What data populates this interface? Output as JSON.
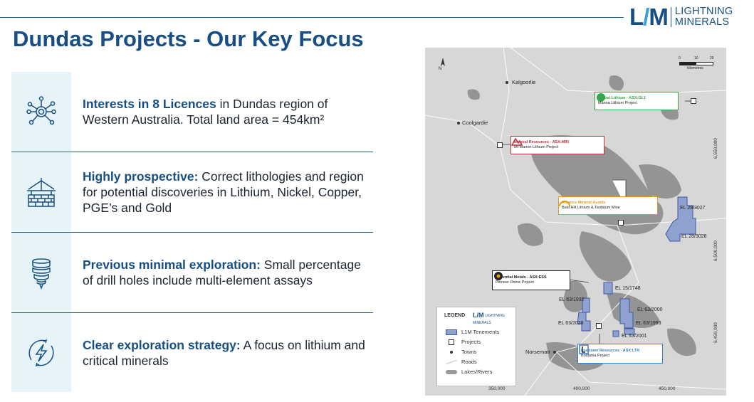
{
  "header": {
    "logo_mark": "L",
    "logo_bolt": "/",
    "logo_mark_end": "M",
    "logo_line1": "LIGHTNING",
    "logo_line2": "MINERALS",
    "title": "Dundas Projects - Our Key Focus"
  },
  "features": [
    {
      "icon": "network-nodes-icon",
      "bold": "Interests in 8 Licences",
      "rest": " in Dundas region of Western Australia. Total land area = 454km²"
    },
    {
      "icon": "drill-rig-icon",
      "bold": "Highly prospective:",
      "rest": " Correct lithologies and region for potential discoveries in Lithium, Nickel, Copper, PGE’s and Gold"
    },
    {
      "icon": "drill-core-icon",
      "bold": "Previous minimal exploration:",
      "rest": " Small percentage of drill holes include multi-element assays"
    },
    {
      "icon": "lightning-circle-icon",
      "bold": "Clear exploration strategy:",
      "rest": " A focus on lithium and critical minerals"
    }
  ],
  "map": {
    "north": "N",
    "scale": {
      "ticks": [
        "0",
        "10",
        "20"
      ],
      "unit": "kilometres"
    },
    "towns": [
      "Kalgoorlie",
      "Coolgardie",
      "Norseman"
    ],
    "projects": [
      {
        "name": "Global Lithium - ASX:GL1",
        "project": "Manna Lithium Project",
        "color": "#3aa54a"
      },
      {
        "name": "Mineral Resources - ASX:MIN",
        "project": "Mt Marion Lithium Project",
        "color": "#c0303a"
      },
      {
        "name": "Alliance Mineral Assets",
        "project": "Bald Hill Lithium & Tantalum Mine",
        "color": "#e39a1c"
      },
      {
        "name": "Essential Metals - ASX:ESS",
        "project": "Pioneer Dome Project",
        "color": "#222222"
      },
      {
        "name": "Liontown Resources - ASX:LTR",
        "project": "Buldania Project",
        "color": "#3a7fc1"
      }
    ],
    "tenements": [
      "EL 28/3027",
      "EL 28/3028",
      "EL 15/1748",
      "EL 63/1932",
      "EL 63/2000",
      "EL 63/1993",
      "EL 63/2028",
      "EL 63/2001"
    ],
    "northings": [
      "6,550,000",
      "6,500,000",
      "6,450,000"
    ],
    "eastings": [
      "350,000",
      "400,000",
      "450,000"
    ],
    "legend": {
      "title": "LEGEND",
      "logo": "L/M",
      "logo_small": "LIGHTNING MINERALS",
      "items": [
        "L1M Tenements",
        "Projects",
        "Towns",
        "Roads",
        "Lakes/Rivers"
      ]
    },
    "colors": {
      "tenement": "#8fa1cf",
      "tenement_border": "#3f57a0",
      "lake": "#8d8d8d",
      "land": "#d7d7d7"
    }
  }
}
